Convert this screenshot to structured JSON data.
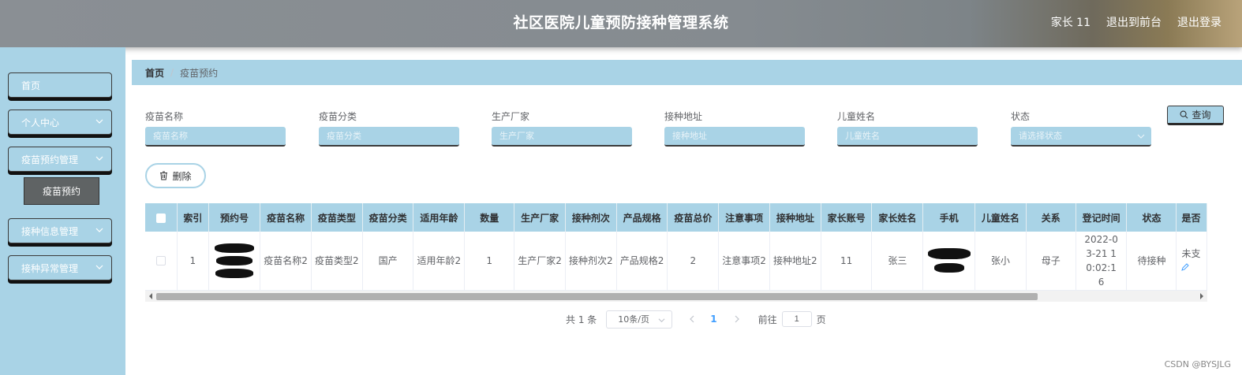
{
  "header": {
    "title": "社区医院儿童预防接种管理系统",
    "user": "家长 11",
    "front_link": "退出到前台",
    "logout": "退出登录"
  },
  "sidebar": {
    "items": [
      {
        "label": "首页",
        "has_arrow": false
      },
      {
        "label": "个人中心",
        "has_arrow": true
      },
      {
        "label": "疫苗预约管理",
        "has_arrow": true
      },
      {
        "label": "接种信息管理",
        "has_arrow": true
      },
      {
        "label": "接种异常管理",
        "has_arrow": true
      }
    ],
    "sub_item": "疫苗预约"
  },
  "breadcrumb": {
    "home": "首页",
    "current": "疫苗预约"
  },
  "search": {
    "fields": [
      {
        "label": "疫苗名称",
        "placeholder": "疫苗名称"
      },
      {
        "label": "疫苗分类",
        "placeholder": "疫苗分类"
      },
      {
        "label": "生产厂家",
        "placeholder": "生产厂家"
      },
      {
        "label": "接种地址",
        "placeholder": "接种地址"
      },
      {
        "label": "儿童姓名",
        "placeholder": "儿童姓名"
      },
      {
        "label": "状态",
        "placeholder": "请选择状态"
      }
    ],
    "query_button": "查询"
  },
  "actions": {
    "delete_button": "删除"
  },
  "table": {
    "columns": [
      "索引",
      "预约号",
      "疫苗名称",
      "疫苗类型",
      "疫苗分类",
      "适用年龄",
      "数量",
      "生产厂家",
      "接种剂次",
      "产品规格",
      "疫苗总价",
      "注意事项",
      "接种地址",
      "家长账号",
      "家长姓名",
      "手机",
      "儿童姓名",
      "关系",
      "登记时间",
      "状态",
      "是否"
    ],
    "rows": [
      {
        "index": "1",
        "vaccine_name": "疫苗名称2",
        "vaccine_type": "疫苗类型2",
        "vaccine_category": "国产",
        "age": "适用年龄2",
        "quantity": "1",
        "manufacturer": "生产厂家2",
        "dose": "接种剂次2",
        "spec": "产品规格2",
        "total_price": "2",
        "notes": "注意事项2",
        "address": "接种地址2",
        "parent_account": "11",
        "parent_name": "张三",
        "child_name": "张小",
        "relation": "母子",
        "reg_time": "2022-03-21 10:02:16",
        "status": "待接种",
        "last_col": "未支"
      }
    ]
  },
  "pagination": {
    "total": "共 1 条",
    "page_size": "10条/页",
    "current_page": "1",
    "goto_label": "前往",
    "goto_value": "1",
    "page_unit": "页"
  },
  "watermark": "CSDN @BYSJLG",
  "colors": {
    "accent": "#a9d3e6",
    "header": "#858b90",
    "link": "#409eff"
  }
}
